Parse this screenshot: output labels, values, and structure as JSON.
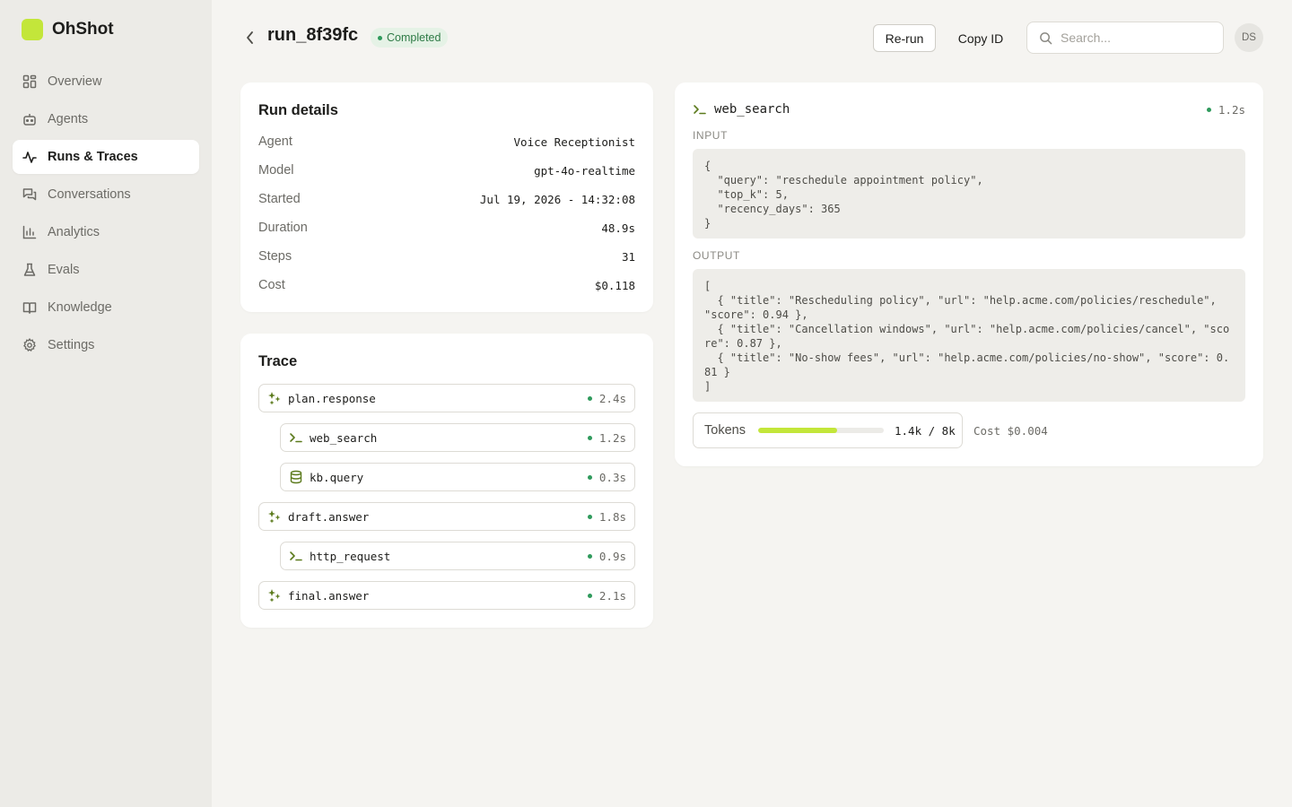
{
  "app": {
    "name": "OhShot",
    "brand_color": "#c3e63a"
  },
  "sidebar": {
    "items": [
      {
        "label": "Overview",
        "icon": "grid-icon",
        "active": false
      },
      {
        "label": "Agents",
        "icon": "bot-icon",
        "active": false
      },
      {
        "label": "Runs & Traces",
        "icon": "activity-icon",
        "active": true
      },
      {
        "label": "Conversations",
        "icon": "messages-icon",
        "active": false
      },
      {
        "label": "Analytics",
        "icon": "bar-chart-icon",
        "active": false
      },
      {
        "label": "Evals",
        "icon": "flask-icon",
        "active": false
      },
      {
        "label": "Knowledge",
        "icon": "book-icon",
        "active": false
      },
      {
        "label": "Settings",
        "icon": "gear-icon",
        "active": false
      }
    ]
  },
  "header": {
    "run_id": "run_8f39fc",
    "status": "Completed",
    "rerun_label": "Re-run",
    "copy_label": "Copy ID",
    "search_placeholder": "Search...",
    "avatar_initials": "DS"
  },
  "details": {
    "title": "Run details",
    "rows": [
      {
        "label": "Agent",
        "value": "Voice Receptionist"
      },
      {
        "label": "Model",
        "value": "gpt-4o-realtime"
      },
      {
        "label": "Started",
        "value": "Jul 19, 2026 - 14:32:08"
      },
      {
        "label": "Duration",
        "value": "48.9s"
      },
      {
        "label": "Steps",
        "value": "31"
      },
      {
        "label": "Cost",
        "value": "$0.118"
      }
    ]
  },
  "trace": {
    "title": "Trace",
    "steps": [
      {
        "name": "plan.response",
        "duration": "2.4s",
        "kind": "llm",
        "icon": "sparkle-icon",
        "depth": 0
      },
      {
        "name": "web_search",
        "duration": "1.2s",
        "kind": "tool",
        "icon": "terminal-icon",
        "depth": 1
      },
      {
        "name": "kb.query",
        "duration": "0.3s",
        "kind": "db",
        "icon": "database-icon",
        "depth": 1
      },
      {
        "name": "draft.answer",
        "duration": "1.8s",
        "kind": "llm",
        "icon": "sparkle-icon",
        "depth": 0
      },
      {
        "name": "http_request",
        "duration": "0.9s",
        "kind": "tool",
        "icon": "terminal-icon",
        "depth": 1
      },
      {
        "name": "final.answer",
        "duration": "2.1s",
        "kind": "llm",
        "icon": "sparkle-icon",
        "depth": 0
      }
    ]
  },
  "selected_step": {
    "name": "web_search",
    "icon": "terminal-icon",
    "duration": "1.2s",
    "input_label": "INPUT",
    "input": "{\n  \"query\": \"reschedule appointment policy\",\n  \"top_k\": 5,\n  \"recency_days\": 365\n}",
    "output_label": "OUTPUT",
    "output": "[\n  { \"title\": \"Rescheduling policy\", \"url\": \"help.acme.com/policies/reschedule\", \"score\": 0.94 },\n  { \"title\": \"Cancellation windows\", \"url\": \"help.acme.com/policies/cancel\", \"score\": 0.87 },\n  { \"title\": \"No-show fees\", \"url\": \"help.acme.com/policies/no-show\", \"score\": 0.81 }\n]",
    "tokens_label": "Tokens",
    "tokens_value": "1.4k / 8k",
    "tokens_fraction": 0.63,
    "cost_text": "Cost $0.004"
  },
  "colors": {
    "status_green": "#2f9a5c",
    "accent": "#c3e63a",
    "icon_olive": "#5b7a1c"
  }
}
